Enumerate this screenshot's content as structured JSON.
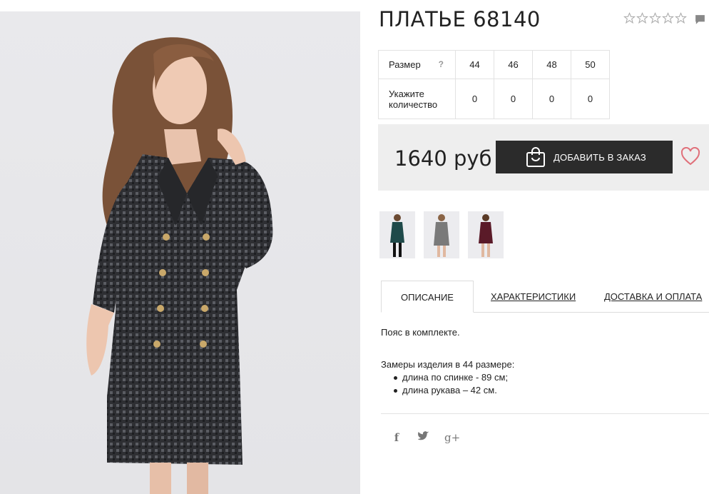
{
  "product": {
    "title": "ПЛАТЬЕ 68140",
    "rating_stars": 5,
    "rating_filled": 0
  },
  "sizes": {
    "size_label": "Размер",
    "help_mark": "?",
    "qty_label_1": "Укажите",
    "qty_label_2": "количество",
    "values": [
      "44",
      "46",
      "48",
      "50"
    ],
    "quantities": [
      "0",
      "0",
      "0",
      "0"
    ]
  },
  "buy": {
    "price": "1640 руб",
    "add_button": "ДОБАВИТЬ В ЗАКАЗ",
    "icons": {
      "bag": "shopping-bag-icon",
      "wishlist": "heart-icon"
    },
    "colors": {
      "button_bg": "#2b2b2b",
      "heart": "#e0707a",
      "box_bg": "#eeeeee"
    }
  },
  "thumbnails": [
    {
      "name": "thumbnail-green-dress",
      "color": "#1f4a4a"
    },
    {
      "name": "thumbnail-grey-dress",
      "color": "#7a7a7a"
    },
    {
      "name": "thumbnail-burgundy-dress",
      "color": "#5a1a28"
    }
  ],
  "tabs": {
    "description": "ОПИСАНИЕ",
    "characteristics": "ХАРАКТЕРИСТИКИ",
    "delivery": "ДОСТАВКА И ОПЛАТА"
  },
  "description": {
    "line1": "Пояс в комплекте.",
    "line2": "Замеры изделия в 44 размере:",
    "items": [
      "длина по спинке - 89 см;",
      "длина рукава – 42 см."
    ]
  },
  "social": {
    "facebook": "f",
    "twitter": "twitter-icon",
    "googleplus": "g+"
  }
}
